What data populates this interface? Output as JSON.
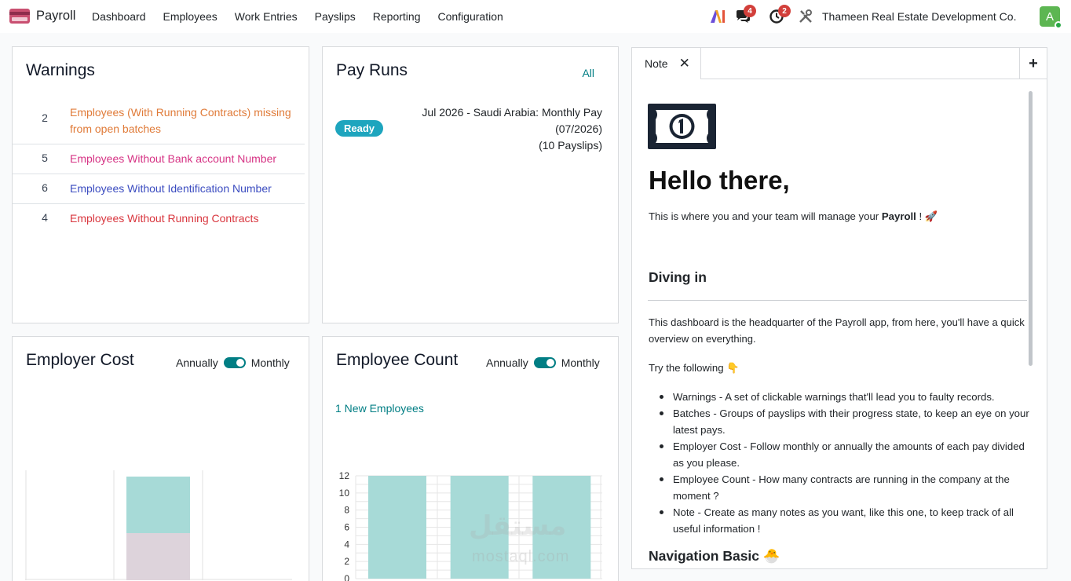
{
  "navbar": {
    "brand": "Payroll",
    "menu": [
      "Dashboard",
      "Employees",
      "Work Entries",
      "Payslips",
      "Reporting",
      "Configuration"
    ],
    "messages_badge": "4",
    "activities_badge": "2",
    "company": "Thameen Real Estate Development Co.",
    "avatar_letter": "A"
  },
  "warnings": {
    "title": "Warnings",
    "items": [
      {
        "count": "2",
        "line1": "Employees (With Running Contracts) missing",
        "line2": "from open batches",
        "color": "#e07b39"
      },
      {
        "count": "5",
        "line1": "Employees Without Bank account Number",
        "line2": "",
        "color": "#d63384"
      },
      {
        "count": "6",
        "line1": "Employees Without Identification Number",
        "line2": "",
        "color": "#3b4cc0"
      },
      {
        "count": "4",
        "line1": "Employees Without Running Contracts",
        "line2": "",
        "color": "#d9363e"
      }
    ]
  },
  "pay_runs": {
    "title": "Pay Runs",
    "all_label": "All",
    "status": "Ready",
    "line1": "Jul 2026 - Saudi Arabia: Monthly Pay",
    "line2": "(07/2026)",
    "line3": "(10 Payslips)"
  },
  "employer_cost": {
    "title": "Employer Cost",
    "annually": "Annually",
    "monthly": "Monthly"
  },
  "employee_count": {
    "title": "Employee Count",
    "annually": "Annually",
    "monthly": "Monthly",
    "new_employees": "1 New Employees"
  },
  "note": {
    "tab_label": "Note",
    "hello": "Hello there,",
    "intro_pre": "This is where you and your team will manage your ",
    "intro_bold": "Payroll",
    "intro_post": " ! 🚀",
    "diving": "Diving in",
    "p1": "This dashboard is the headquarter of the Payroll app, from here, you'll have a quick overview on everything.",
    "try": "Try the following 👇",
    "list": [
      "Warnings - A set of clickable warnings that'll lead you to faulty records.",
      "Batches - Groups of payslips with their progress state, to keep an eye on your latest pays.",
      "Employer Cost - Follow monthly or annually the amounts of each pay divided as you please.",
      "Employee Count - How many contracts are running in the company at the moment ?",
      "Note - Create as many notes as you want, like this one, to keep track of all useful information !"
    ],
    "nav_basic": "Navigation Basic 🐣"
  },
  "chart_data": [
    {
      "type": "bar",
      "chart": "employer_cost",
      "categories": [
        "",
        "",
        ""
      ],
      "series": [
        {
          "values": [
            0,
            50,
            0
          ],
          "color": "#ddd3db"
        },
        {
          "values": [
            0,
            60,
            0
          ],
          "color": "#a7dad7"
        }
      ],
      "title": "",
      "xlabel": "",
      "ylabel": ""
    },
    {
      "type": "bar",
      "chart": "employee_count",
      "categories": [
        "",
        "",
        ""
      ],
      "values": [
        12,
        12,
        12
      ],
      "yticks": [
        "0",
        "2",
        "4",
        "6",
        "8",
        "10",
        "12"
      ],
      "ylim": [
        0,
        12
      ],
      "color": "#a7dad7",
      "title": "",
      "xlabel": "",
      "ylabel": ""
    }
  ],
  "watermark": {
    "arabic": "مستقل",
    "latin": "mostaql.com"
  }
}
